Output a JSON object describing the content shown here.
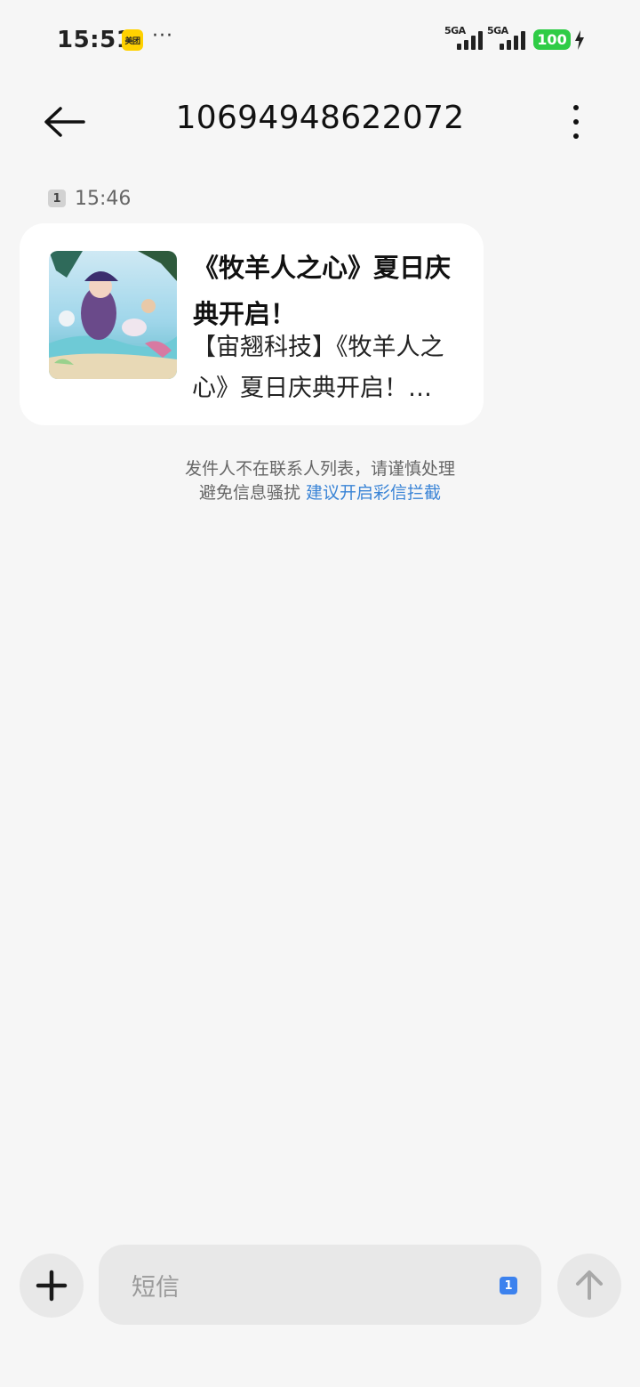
{
  "status_bar": {
    "time": "15:51",
    "app_badge": "美团",
    "more": "···",
    "sim1_network": "5GA",
    "sim2_network": "5GA",
    "battery_level": "100"
  },
  "app_bar": {
    "title": "10694948622072"
  },
  "conversation": {
    "sim_slot": "1",
    "timestamp": "15:46",
    "card": {
      "title": "《牧羊人之心》夏日庆典开启！",
      "body": "【宙翘科技】《牧羊人之心》夏日庆典开启！…"
    },
    "notice": {
      "line1": "发件人不在联系人列表，请谨慎处理",
      "line2_text": "避免信息骚扰",
      "line2_link": "建议开启彩信拦截"
    }
  },
  "composer": {
    "placeholder": "短信",
    "sim_slot": "1"
  },
  "colors": {
    "background": "#f6f6f6",
    "card": "#ffffff",
    "link": "#3a84d6",
    "battery": "#2fcc46",
    "sim_badge_active": "#3c82ee"
  },
  "icons": {
    "back": "arrow-left-icon",
    "menu": "more-vertical-icon",
    "add": "plus-icon",
    "send": "arrow-up-icon",
    "charging": "bolt-icon"
  }
}
